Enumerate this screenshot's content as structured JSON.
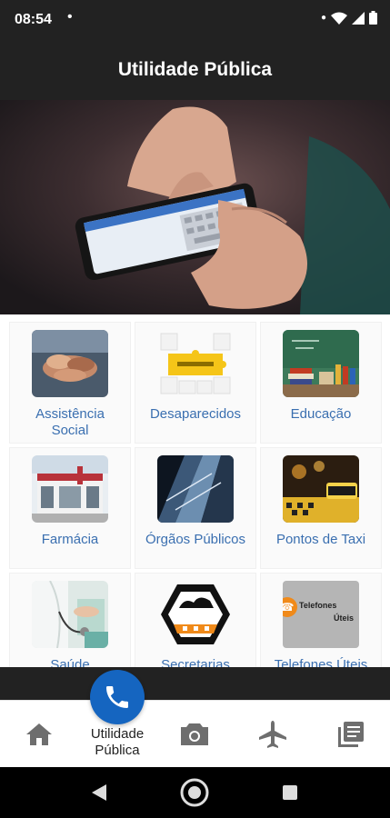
{
  "status": {
    "time": "08:54",
    "dot": "•"
  },
  "app": {
    "title": "Utilidade Pública"
  },
  "grid": {
    "items": [
      {
        "label": "Assistência Social",
        "icon": "hands-together-icon"
      },
      {
        "label": "Desaparecidos",
        "icon": "puzzle-icon"
      },
      {
        "label": "Educação",
        "icon": "chalkboard-books-icon"
      },
      {
        "label": "Farmácia",
        "icon": "pharmacy-building-icon"
      },
      {
        "label": "Órgãos Públicos",
        "icon": "skyscraper-icon"
      },
      {
        "label": "Pontos de Taxi",
        "icon": "taxi-sign-icon"
      },
      {
        "label": "Saúde",
        "icon": "doctor-stethoscope-icon"
      },
      {
        "label": "Secretarias",
        "icon": "hexagon-gear-icon"
      },
      {
        "label": "Telefones Úteis",
        "icon": "phone-card-icon",
        "card_text_1": "Telefones",
        "card_text_2": "Úteis"
      }
    ]
  },
  "bottom_nav": {
    "active_label": "Utilidade Pública",
    "items": [
      "home-icon",
      "phone-icon",
      "camera-icon",
      "airplane-icon",
      "library-icon"
    ]
  },
  "colors": {
    "accent": "#1565c0",
    "label": "#3a6fb0",
    "bar": "#222222"
  }
}
